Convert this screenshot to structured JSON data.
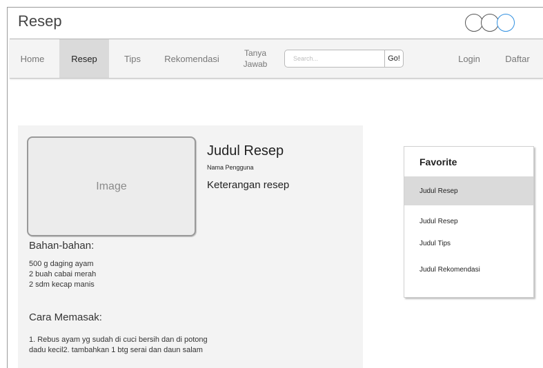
{
  "app": {
    "title": "Resep"
  },
  "nav": {
    "items": [
      {
        "label": "Home"
      },
      {
        "label": "Resep"
      },
      {
        "label": "Tips"
      },
      {
        "label": "Rekomendasi"
      }
    ],
    "tanya_line1": "Tanya",
    "tanya_line2": "Jawab",
    "search_placeholder": "Search...",
    "go_label": "Go!",
    "login_label": "Login",
    "daftar_label": "Daftar"
  },
  "recipe": {
    "image_label": "Image",
    "title": "Judul Resep",
    "user": "Nama Pengguna",
    "description": "Keterangan resep",
    "ingredients_heading": "Bahan-bahan:",
    "ingredients": [
      "500 g daging ayam",
      "2 buah cabai merah",
      "2 sdm kecap manis"
    ],
    "steps_heading": "Cara Memasak:",
    "steps_line1": "1. Rebus ayam yg sudah di cuci bersih dan di potong",
    "steps_line2": "dadu kecil2. tambahkan 1 btg serai dan daun salam"
  },
  "favorite": {
    "title": "Favorite",
    "items": [
      {
        "label": "Judul Resep"
      },
      {
        "label": "Judul Resep"
      },
      {
        "label": "Judul Tips"
      },
      {
        "label": "Judul Rekomendasi"
      }
    ]
  }
}
